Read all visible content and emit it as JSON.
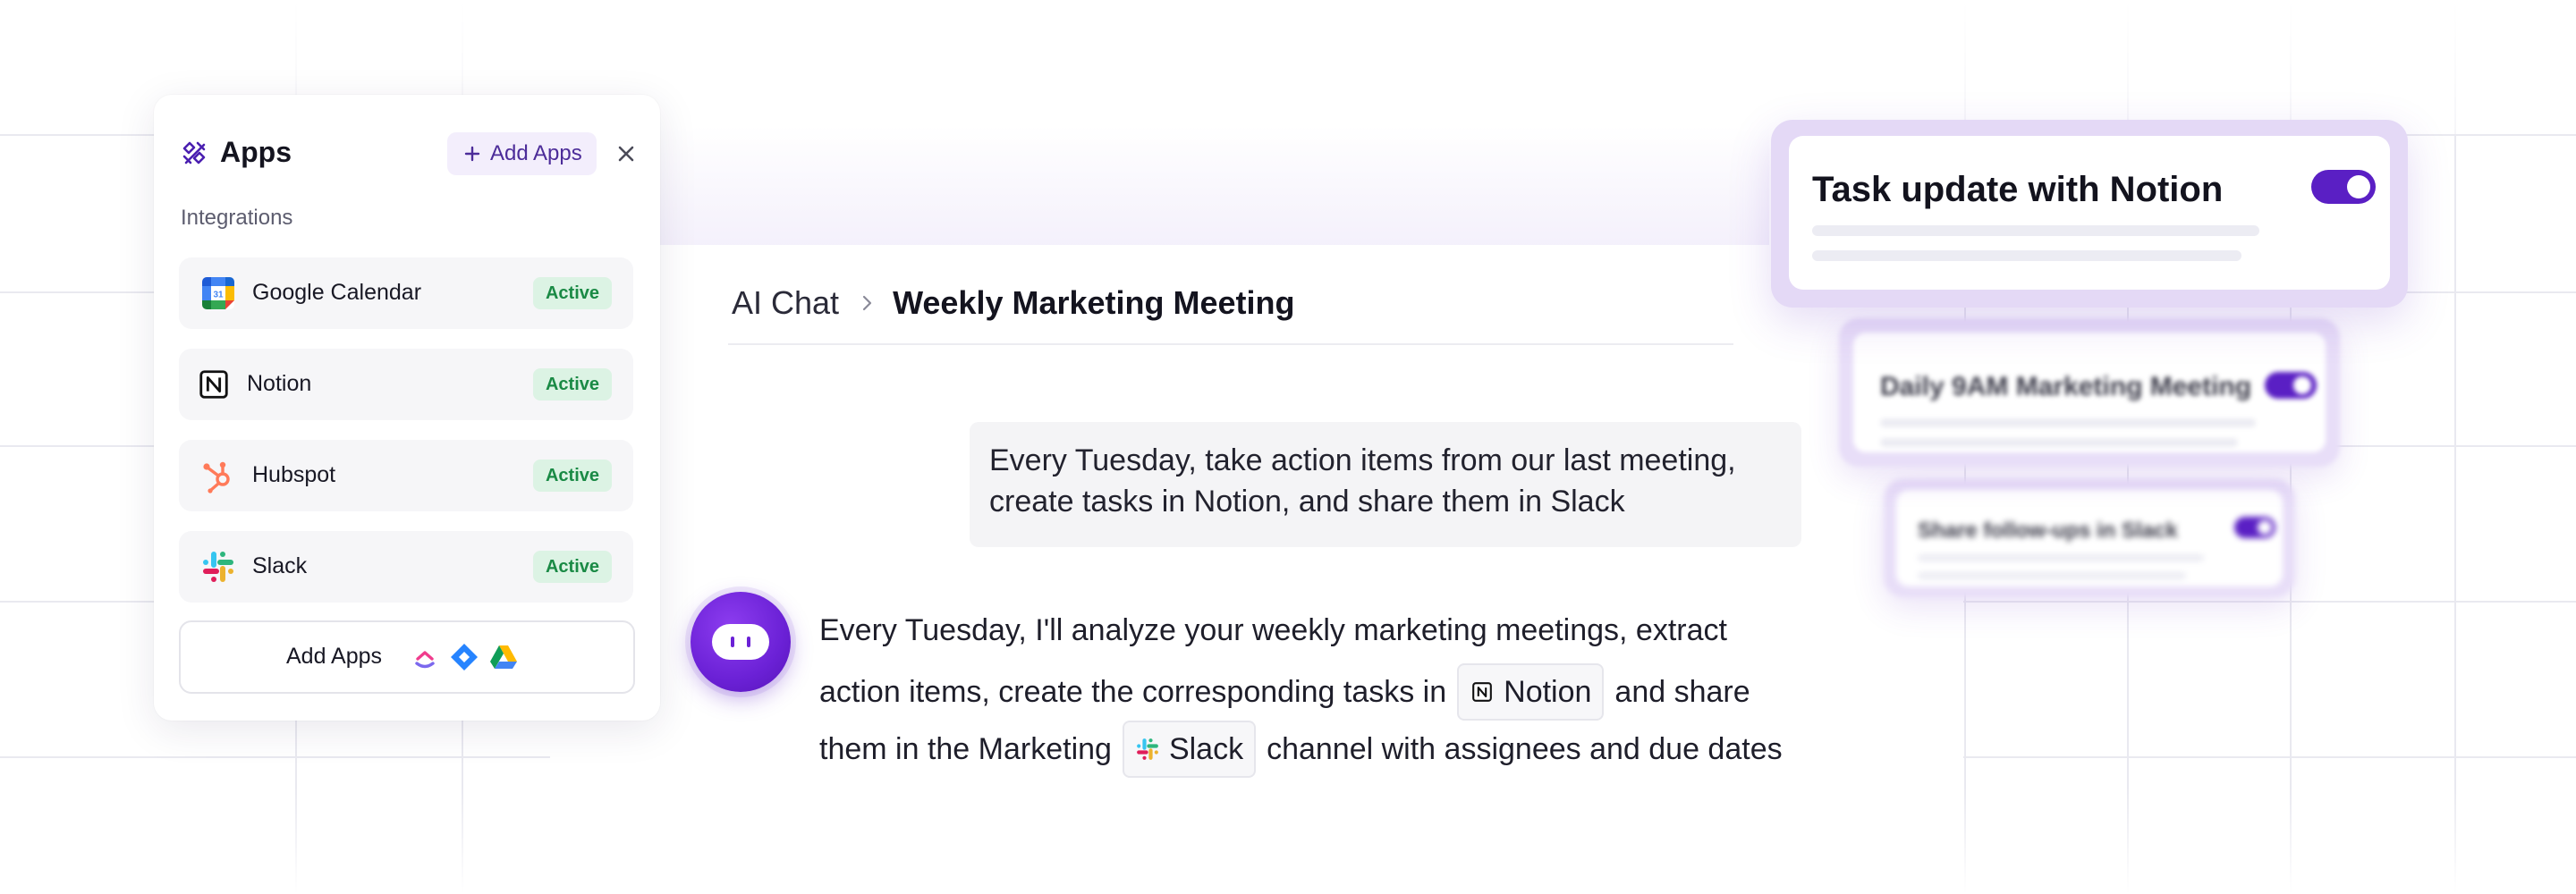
{
  "apps_panel": {
    "title": "Apps",
    "add_button_label": "Add Apps",
    "integrations_label": "Integrations",
    "integrations": [
      {
        "name": "Google Calendar",
        "status": "Active"
      },
      {
        "name": "Notion",
        "status": "Active"
      },
      {
        "name": "Hubspot",
        "status": "Active"
      },
      {
        "name": "Slack",
        "status": "Active"
      }
    ],
    "add_apps_row_label": "Add Apps"
  },
  "chat": {
    "breadcrumb": {
      "root": "AI Chat",
      "current": "Weekly Marketing Meeting"
    },
    "user_message_lines": [
      "Every Tuesday, take action items from our last meeting,",
      "create tasks in Notion, and share them in Slack"
    ],
    "bot_message": {
      "line1": "Every Tuesday, I'll analyze your weekly marketing meetings, extract",
      "line2_before": "action items, create the corresponding tasks in",
      "line2_chip": "Notion",
      "line2_after": "and share",
      "line3_before": "them in the Marketing",
      "line3_chip": "Slack",
      "line3_after": "channel with assignees and due dates"
    }
  },
  "automations": [
    {
      "title": "Task update with Notion",
      "enabled": true
    },
    {
      "title": "Daily 9AM Marketing Meeting",
      "enabled": true
    },
    {
      "title": "Share follow-ups in Slack",
      "enabled": true
    }
  ],
  "colors": {
    "accent": "#5a1fc4",
    "accent_light": "#f3eefc",
    "active_badge_bg": "#dcf3e4",
    "active_badge_text": "#1a8a45"
  }
}
